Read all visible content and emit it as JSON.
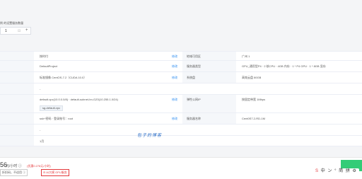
{
  "config": {
    "qty_label": "例 的设置服务数量",
    "qty_value": "1",
    "qty_minus": "⊟",
    "qty_plus": "+"
  },
  "rows": {
    "r1": {
      "left": "按时付",
      "edit": "修改",
      "right_label": "地域可用区",
      "right_value": "广州 1"
    },
    "r2": {
      "left": "DefaultProject",
      "edit": "修改",
      "right_label": "服务器类型",
      "right_value": "GPU_通用型P4 · 2 核CPU · 4GB 内存 · 1 * P4 GPU · 1 * 8GB 显存"
    },
    "r3": {
      "left": "标准镜像 CentOS-7.2（CUDA 10.0）",
      "edit": "修改",
      "right_label": "系统盘",
      "right_value": "高效云盘 80GB"
    },
    "r4": {
      "left": "-"
    },
    "r5": {
      "left": "default-vpc(10.0.0.0/8) · default-subnet-hn-GZ0(10.255.1.0/24)",
      "edit": "修改",
      "right_label": "弹性公网IP",
      "right_value": "按固定带宽 1Mbps"
    },
    "r6": {
      "tag": "sg-default-vpc"
    },
    "r7": {
      "left": "ssh+密码 · 登录账号：root",
      "edit": "修改",
      "right_label": "服务器名称",
      "right_value": "Cent0S7.2-RD-1M"
    },
    "r8": {
      "left": "-"
    },
    "r9": {
      "left": "1月"
    }
  },
  "watermark": "包子的博客",
  "footer": {
    "price_big": "56",
    "price_unit": "元/小时 ⓘ",
    "price_orig": "(优惠0.278元/小时)",
    "promo1": "折扣码，不适用 ⓘ",
    "promo2": "⊟ AI大模 GPU服务",
    "toolbar": [
      "中",
      "ン",
      "°",
      "简",
      "拼",
      "⚙"
    ]
  }
}
